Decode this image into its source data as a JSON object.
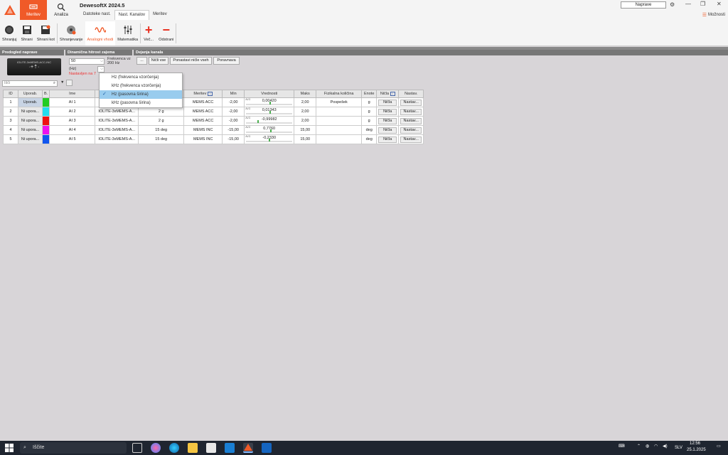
{
  "app": {
    "title": "DewesoftX 2024.5",
    "modules": [
      {
        "label": "Meritev",
        "active": true
      },
      {
        "label": "Analiza",
        "active": false
      }
    ],
    "subtabs": [
      {
        "label": "Datoteke nast.",
        "active": false
      },
      {
        "label": "Nast. Kanalov",
        "active": true
      },
      {
        "label": "Meritev",
        "active": false
      }
    ],
    "devices_button": "Naprave",
    "options_label": "Možnosti",
    "accent_color": "#f05a28"
  },
  "ribbon": [
    {
      "label": "Shranjuj",
      "icon": "record-icon"
    },
    {
      "label": "Shrani",
      "icon": "save-icon"
    },
    {
      "label": "Shrani kot",
      "icon": "save-as-icon"
    },
    {
      "label": "Shranjevanje",
      "icon": "storage-icon"
    },
    {
      "label": "Analogni vhodi",
      "icon": "analog-wave-icon",
      "active": true
    },
    {
      "label": "Matematika",
      "icon": "math-sliders-icon"
    },
    {
      "label": "Več...",
      "icon": "plus-icon"
    },
    {
      "label": "Odstrani",
      "icon": "minus-icon"
    }
  ],
  "sections": {
    "device_preview": "Predogled naprave",
    "dynamic_rate": "Dinamična hitrost zajema",
    "channel_actions": "Dejanja kanala"
  },
  "device_image_label": "IOLITE-3xMEMS-ACC-INC",
  "rate": {
    "value": "50",
    "unit_label": "Frekvenca vz",
    "unit_value": "200 Hz",
    "unit_combo": "(Hz)",
    "warning": "Nastavljen na 7"
  },
  "channel_buttons": [
    "...",
    "Ničli vse",
    "Ponastavi ničle vseh",
    "Poravnava"
  ],
  "search": {
    "placeholder": "Išči"
  },
  "table": {
    "headers": [
      "ID",
      "Uporab.",
      "B.",
      "Ime",
      "",
      "",
      "Meritev",
      "Min",
      "Vrednosti",
      "Maks",
      "Fizikalna količina",
      "Enote",
      "Ničla",
      "Nastav."
    ],
    "rows": [
      {
        "id": "1",
        "usage": "Uporab.",
        "used": true,
        "color": "#22cc22",
        "name": "AI 1",
        "amp": "IOLI",
        "range": "",
        "meas": "MEMS ACC",
        "min": "-2,00",
        "val_label": "AVG",
        "value": "0,00420",
        "pos": 0.5,
        "max": "2,00",
        "quantity": "Pospešek",
        "unit": "g",
        "zero": "Ničla",
        "setup": "Nastav..."
      },
      {
        "id": "2",
        "usage": "Ni upora...",
        "used": false,
        "color": "#22ddee",
        "name": "AI 2",
        "amp": "IOLITE-3xMEMS-A...",
        "range": "2 g",
        "meas": "MEMS ACC",
        "min": "-2,00",
        "val_label": "AVG",
        "value": "0,01343",
        "pos": 0.5,
        "max": "2,00",
        "quantity": "",
        "unit": "g",
        "zero": "Ničla",
        "setup": "Nastav..."
      },
      {
        "id": "3",
        "usage": "Ni upora...",
        "used": false,
        "color": "#ee1111",
        "name": "AI 3",
        "amp": "IOLITE-3xMEMS-A...",
        "range": "2 g",
        "meas": "MEMS ACC",
        "min": "-2,00",
        "val_label": "AVG",
        "value": "-0,99982",
        "pos": 0.25,
        "max": "2,00",
        "quantity": "",
        "unit": "g",
        "zero": "Ničla",
        "setup": "Nastav..."
      },
      {
        "id": "4",
        "usage": "Ni upora...",
        "used": false,
        "color": "#ee11ee",
        "name": "AI 4",
        "amp": "IOLITE-3xMEMS-A...",
        "range": "15 deg",
        "meas": "MEMS INC",
        "min": "-15,00",
        "val_label": "AVG",
        "value": "0,7760",
        "pos": 0.52,
        "max": "15,00",
        "quantity": "",
        "unit": "deg",
        "zero": "Ničla",
        "setup": "Nastav..."
      },
      {
        "id": "5",
        "usage": "Ni upora...",
        "used": false,
        "color": "#1155ee",
        "name": "AI 5",
        "amp": "IOLITE-3xMEMS-A...",
        "range": "15 deg",
        "meas": "MEMS INC",
        "min": "-15,00",
        "val_label": "AVG",
        "value": "-0,2330",
        "pos": 0.49,
        "max": "15,00",
        "quantity": "",
        "unit": "deg",
        "zero": "Ničla",
        "setup": "Nastav..."
      }
    ]
  },
  "dropdown": {
    "items": [
      {
        "label": "Hz (frekvenca vzorčenja)",
        "selected": false
      },
      {
        "label": "kHz (frekvenca vzorčenja)",
        "selected": false
      },
      {
        "label": "Hz (pasovna širina)",
        "selected": true
      },
      {
        "label": "kHz (pasovna širina)",
        "selected": false
      }
    ]
  },
  "taskbar": {
    "search_placeholder": "Iščite",
    "language": "SLV",
    "time": "12:56",
    "date": "25.1.2025"
  }
}
